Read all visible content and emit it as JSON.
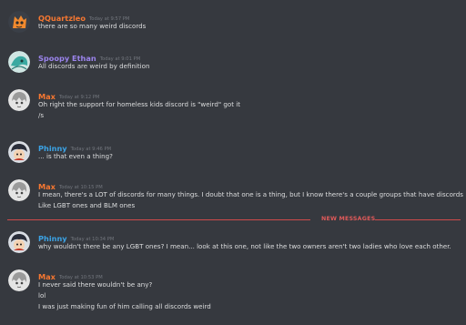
{
  "colors": {
    "background": "#36393f",
    "qquartzleo": "#f57731",
    "spoopy_ethan": "#9b84ec",
    "max": "#f57731",
    "phinny": "#3ba3e5",
    "new_messages": "#e05a5a"
  },
  "messages": [
    {
      "author": "QQuartzleo",
      "timestamp": "Today at 9:57 PM",
      "avatar_icon": "orange-cartoon-avatar-icon",
      "lines": [
        "there are so many weird discords"
      ]
    },
    {
      "author": "Spoopy Ethan",
      "timestamp": "Today at 9:01 PM",
      "avatar_icon": "teal-cartoon-avatar-icon",
      "lines": [
        "All discords are weird by definition"
      ]
    },
    {
      "author": "Max",
      "timestamp": "Today at 9:12 PM",
      "avatar_icon": "anime-avatar-icon",
      "lines": [
        "Oh right the support for homeless kids discord is \"weird\" got it",
        "/s"
      ]
    },
    {
      "author": "Phinny",
      "timestamp": "Today at 9:46 PM",
      "avatar_icon": "character-avatar-icon",
      "lines": [
        "... is that even a thing?"
      ]
    },
    {
      "author": "Max",
      "timestamp": "Today at 10:15 PM",
      "avatar_icon": "anime-avatar-icon",
      "lines": [
        "I mean, there's a LOT of discords for many things. I doubt that one is a thing, but I know there's a couple groups that have discords",
        "Like LGBT ones and BLM ones"
      ]
    },
    {
      "author": "Phinny",
      "timestamp": "Today at 10:34 PM",
      "avatar_icon": "character-avatar-icon",
      "lines": [
        "why wouldn't there be any LGBT ones? I mean... look at this one, not like the two owners aren't two ladies who love each other."
      ]
    },
    {
      "author": "Max",
      "timestamp": "Today at 10:53 PM",
      "avatar_icon": "anime-avatar-icon",
      "lines": [
        "I never said there wouldn't be any?",
        "lol",
        "I was just making fun of him calling all discords weird"
      ]
    }
  ],
  "divider": {
    "label": "NEW MESSAGES"
  }
}
